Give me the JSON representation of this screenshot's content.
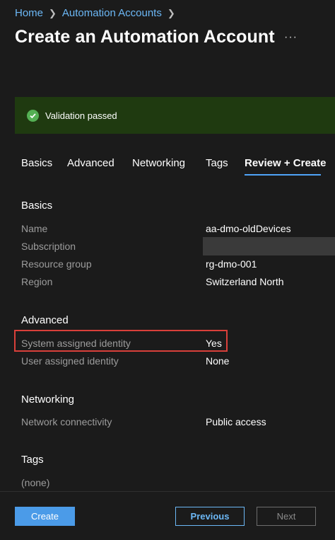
{
  "breadcrumb": {
    "items": [
      "Home",
      "Automation Accounts"
    ]
  },
  "page": {
    "title": "Create an Automation Account",
    "more": "···"
  },
  "banner": {
    "message": "Validation passed",
    "color": "#54b054"
  },
  "tabs": [
    {
      "label": "Basics"
    },
    {
      "label": "Advanced"
    },
    {
      "label": "Networking"
    },
    {
      "label": "Tags"
    },
    {
      "label": "Review + Create",
      "active": true
    }
  ],
  "sections": {
    "basics": {
      "heading": "Basics",
      "rows": [
        {
          "label": "Name",
          "value": "aa-dmo-oldDevices"
        },
        {
          "label": "Subscription",
          "value": ""
        },
        {
          "label": "Resource group",
          "value": "rg-dmo-001"
        },
        {
          "label": "Region",
          "value": "Switzerland North"
        }
      ]
    },
    "advanced": {
      "heading": "Advanced",
      "rows": [
        {
          "label": "System assigned identity",
          "value": "Yes"
        },
        {
          "label": "User assigned identity",
          "value": "None"
        }
      ]
    },
    "networking": {
      "heading": "Networking",
      "rows": [
        {
          "label": "Network connectivity",
          "value": "Public access"
        }
      ]
    },
    "tags": {
      "heading": "Tags",
      "rows": [
        {
          "label": "(none)"
        }
      ]
    }
  },
  "footer": {
    "create": "Create",
    "previous": "Previous",
    "next": "Next"
  },
  "colors": {
    "accent": "#4b9be8",
    "link": "#6cb8f6",
    "highlight": "#d9403a",
    "banner_bg": "#1f3a10"
  }
}
